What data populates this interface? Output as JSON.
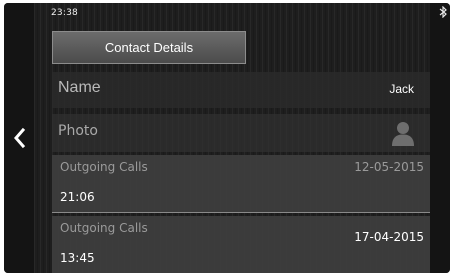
{
  "status_bar": {
    "time": "23:38",
    "bluetooth_icon": "bluetooth-icon"
  },
  "header": {
    "title": "Contact Details"
  },
  "navigation": {
    "back_icon": "chevron-left-icon"
  },
  "contact": {
    "name_label": "Name",
    "name_value": "Jack",
    "photo_label": "Photo",
    "photo_icon": "person-silhouette-icon"
  },
  "calls": [
    {
      "type": "Outgoing Calls",
      "date": "12-05-2015",
      "time": "21:06"
    },
    {
      "type": "Outgoing Calls",
      "date": "17-04-2015",
      "time": "13:45"
    }
  ],
  "colors": {
    "background": "#1e1e1e",
    "title_box": "#5b5b5b",
    "row_highlight": "#3e3e3e",
    "text_primary": "#ffffff",
    "text_secondary": "#9a9a9a"
  }
}
